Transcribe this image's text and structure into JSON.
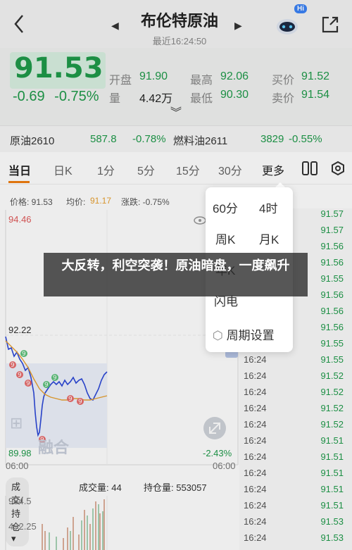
{
  "header": {
    "title": "布伦特原油",
    "subtitle": "最近16:24:50",
    "badge": "Hi"
  },
  "quote": {
    "price": "91.53",
    "change": "-0.69",
    "change_pct": "-0.75%",
    "open_label": "开盘",
    "open": "91.90",
    "high_label": "最高",
    "high": "92.06",
    "bid_label": "买价",
    "bid": "91.52",
    "volume_label": "量",
    "volume": "4.42万",
    "low_label": "最低",
    "low": "90.30",
    "ask_label": "卖价",
    "ask": "91.54"
  },
  "related": [
    {
      "name": "原油2610",
      "price": "587.8",
      "pct": "-0.78%"
    },
    {
      "name": "燃料油2611",
      "price": "3829",
      "pct": "-0.55%"
    }
  ],
  "tabs": [
    "当日",
    "日K",
    "1分",
    "5分",
    "15分",
    "30分",
    "更多"
  ],
  "infobar": {
    "price": "价格: 91.53",
    "avg_label": "均价: ",
    "avg": "91.17",
    "change": "涨跌: -0.75%"
  },
  "chart": {
    "high": "94.46",
    "mid": "92.22",
    "low": "89.98",
    "low_pct": "-2.43%",
    "time_start": "06:00",
    "time_end": "06:00",
    "watermark": "融合"
  },
  "volume": {
    "mode": "成交/持仓",
    "volume": "成交量: 44",
    "open_interest": "持仓量: 553057",
    "axis_top": "984.5",
    "axis_mid": "492.25"
  },
  "ticks": [
    {
      "time": "",
      "price": "91.57"
    },
    {
      "time": "",
      "price": "91.57"
    },
    {
      "time": "",
      "price": "91.56"
    },
    {
      "time": "",
      "price": "91.56"
    },
    {
      "time": "",
      "price": "91.55"
    },
    {
      "time": "",
      "price": "91.56"
    },
    {
      "time": "",
      "price": "91.56"
    },
    {
      "time": "",
      "price": "91.56"
    },
    {
      "time": "",
      "price": "91.55"
    },
    {
      "time": "16:24",
      "price": "91.55"
    },
    {
      "time": "16:24",
      "price": "91.52"
    },
    {
      "time": "16:24",
      "price": "91.52"
    },
    {
      "time": "16:24",
      "price": "91.52"
    },
    {
      "time": "16:24",
      "price": "91.52"
    },
    {
      "time": "16:24",
      "price": "91.51"
    },
    {
      "time": "16:24",
      "price": "91.51"
    },
    {
      "time": "16:24",
      "price": "91.51"
    },
    {
      "time": "16:24",
      "price": "91.51"
    },
    {
      "time": "16:24",
      "price": "91.51"
    },
    {
      "time": "16:24",
      "price": "91.53"
    },
    {
      "time": "16:24",
      "price": "91.53"
    }
  ],
  "popup": {
    "items": [
      "60分",
      "4时",
      "周K",
      "月K",
      "年K",
      "闪电",
      "周期设置"
    ]
  },
  "banner": {
    "text": "大反转，利空突袭！原油暗盘，一度飙升"
  },
  "colors": {
    "green": "#1f9a4a",
    "accent": "#f07d10",
    "blue_line": "#2c48d8",
    "avg_line": "#e8a030"
  }
}
